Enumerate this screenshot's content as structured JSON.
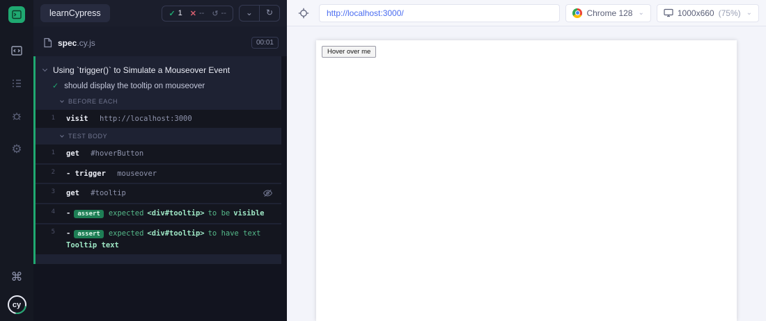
{
  "app": {
    "title": "learnCypress"
  },
  "icons": {
    "passed": "✓",
    "failed": "✕",
    "pending": "↺",
    "collapse_chevron": "⌄",
    "rerun": "↻",
    "keyboard": "⌘",
    "settings": "⚙",
    "select_chevron": "⌄",
    "cy_logo_text": "cy"
  },
  "header": {
    "passed_count": "1",
    "failed_count": "--",
    "pending_count": "--"
  },
  "spec": {
    "name": "spec",
    "ext": ".cy.js",
    "duration": "00:01"
  },
  "suite": {
    "title": "Using `trigger()` to Simulate a Mouseover Event",
    "test_title": "should display the tooltip on mouseover"
  },
  "sections": {
    "before_each": {
      "label": "BEFORE EACH",
      "cmd1": {
        "num": "1",
        "method": "visit",
        "message": "http://localhost:3000"
      }
    },
    "test_body": {
      "label": "TEST BODY",
      "cmd1": {
        "num": "1",
        "method": "get",
        "message": "#hoverButton"
      },
      "cmd2": {
        "num": "2",
        "method": "- trigger",
        "message": "mouseover"
      },
      "cmd3": {
        "num": "3",
        "method": "get",
        "message": "#tooltip"
      },
      "cmd4": {
        "num": "4",
        "dash": "-",
        "badge": "assert",
        "p1": "expected",
        "s1": "<div#tooltip>",
        "p2": "to be",
        "s2": "visible"
      },
      "cmd5": {
        "num": "5",
        "dash": "-",
        "badge": "assert",
        "p1": "expected",
        "s1": "<div#tooltip>",
        "p2": "to have text",
        "s2": "Tooltip text"
      }
    }
  },
  "toolbar": {
    "url": "http://localhost:3000/",
    "browser": "Chrome 128",
    "viewport": "1000x660",
    "scale": "(75%)"
  },
  "aut": {
    "button_label": "Hover over me"
  }
}
